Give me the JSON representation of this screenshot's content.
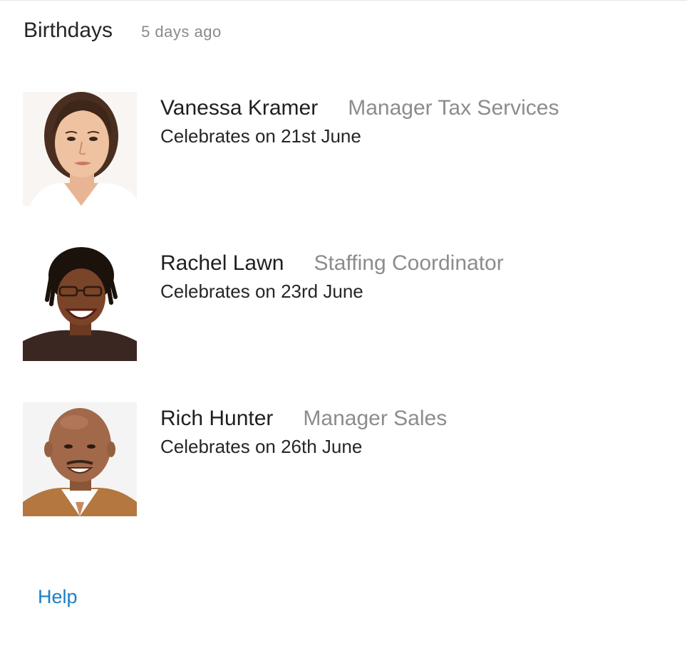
{
  "header": {
    "title": "Birthdays",
    "time_ago": "5 days ago"
  },
  "people": [
    {
      "name": "Vanessa Kramer",
      "job_title": "Manager Tax Services",
      "celebrates": "Celebrates on 21st June"
    },
    {
      "name": "Rachel Lawn",
      "job_title": "Staffing Coordinator",
      "celebrates": "Celebrates on 23rd June"
    },
    {
      "name": "Rich Hunter",
      "job_title": "Manager Sales",
      "celebrates": "Celebrates on 26th June"
    }
  ],
  "footer": {
    "help_label": "Help"
  },
  "colors": {
    "link": "#1a7fc7",
    "secondary_text": "#8c8c8c",
    "primary_text": "#1f1f1f"
  }
}
